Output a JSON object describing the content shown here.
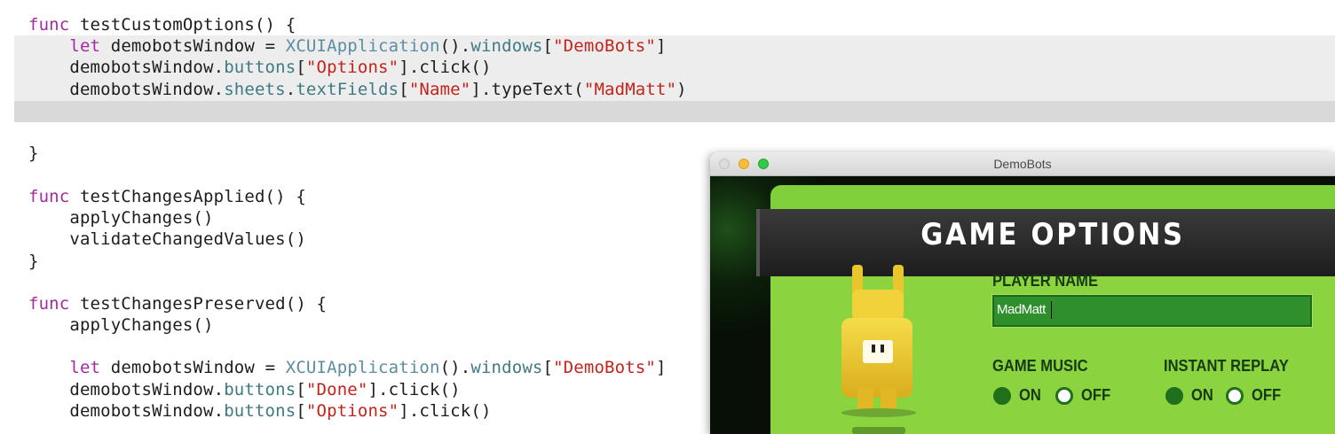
{
  "code": {
    "lines": [
      {
        "id": "l1",
        "segments": [
          {
            "t": "func",
            "c": "kw"
          },
          {
            "t": " testCustomOptions() {",
            "c": ""
          }
        ]
      },
      {
        "id": "l2",
        "segments": [
          {
            "t": "    ",
            "c": ""
          },
          {
            "t": "let",
            "c": "kw"
          },
          {
            "t": " demobotsWindow = ",
            "c": ""
          },
          {
            "t": "XCUIApplication",
            "c": "cls"
          },
          {
            "t": "().",
            "c": ""
          },
          {
            "t": "windows",
            "c": "prop"
          },
          {
            "t": "[",
            "c": ""
          },
          {
            "t": "\"DemoBots\"",
            "c": "str"
          },
          {
            "t": "]",
            "c": ""
          }
        ]
      },
      {
        "id": "l3",
        "segments": [
          {
            "t": "    demobotsWindow.",
            "c": ""
          },
          {
            "t": "buttons",
            "c": "prop"
          },
          {
            "t": "[",
            "c": ""
          },
          {
            "t": "\"Options\"",
            "c": "str"
          },
          {
            "t": "].click()",
            "c": ""
          }
        ]
      },
      {
        "id": "l4",
        "segments": [
          {
            "t": "    demobotsWindow.",
            "c": ""
          },
          {
            "t": "sheets",
            "c": "prop"
          },
          {
            "t": ".",
            "c": ""
          },
          {
            "t": "textFields",
            "c": "prop"
          },
          {
            "t": "[",
            "c": ""
          },
          {
            "t": "\"Name\"",
            "c": "str"
          },
          {
            "t": "].typeText(",
            "c": ""
          },
          {
            "t": "\"MadMatt\"",
            "c": "str"
          },
          {
            "t": ")",
            "c": ""
          }
        ]
      },
      {
        "id": "l5",
        "segments": [
          {
            "t": "}",
            "c": ""
          }
        ]
      },
      {
        "id": "l6",
        "segments": [
          {
            "t": "func",
            "c": "kw"
          },
          {
            "t": " testChangesApplied() {",
            "c": ""
          }
        ]
      },
      {
        "id": "l7",
        "segments": [
          {
            "t": "    applyChanges()",
            "c": ""
          }
        ]
      },
      {
        "id": "l8",
        "segments": [
          {
            "t": "    validateChangedValues()",
            "c": ""
          }
        ]
      },
      {
        "id": "l9",
        "segments": [
          {
            "t": "}",
            "c": ""
          }
        ]
      },
      {
        "id": "l10",
        "segments": [
          {
            "t": "func",
            "c": "kw"
          },
          {
            "t": " testChangesPreserved() {",
            "c": ""
          }
        ]
      },
      {
        "id": "l11",
        "segments": [
          {
            "t": "    applyChanges()",
            "c": ""
          }
        ]
      },
      {
        "id": "l12",
        "segments": [
          {
            "t": "    ",
            "c": ""
          },
          {
            "t": "let",
            "c": "kw"
          },
          {
            "t": " demobotsWindow = ",
            "c": ""
          },
          {
            "t": "XCUIApplication",
            "c": "cls"
          },
          {
            "t": "().",
            "c": ""
          },
          {
            "t": "windows",
            "c": "prop"
          },
          {
            "t": "[",
            "c": ""
          },
          {
            "t": "\"DemoBots\"",
            "c": "str"
          },
          {
            "t": "]",
            "c": ""
          }
        ]
      },
      {
        "id": "l13",
        "segments": [
          {
            "t": "    demobotsWindow.",
            "c": ""
          },
          {
            "t": "buttons",
            "c": "prop"
          },
          {
            "t": "[",
            "c": ""
          },
          {
            "t": "\"Done\"",
            "c": "str"
          },
          {
            "t": "].click()",
            "c": ""
          }
        ]
      },
      {
        "id": "l14",
        "segments": [
          {
            "t": "    demobotsWindow.",
            "c": ""
          },
          {
            "t": "buttons",
            "c": "prop"
          },
          {
            "t": "[",
            "c": ""
          },
          {
            "t": "\"Options\"",
            "c": "str"
          },
          {
            "t": "].click()",
            "c": ""
          }
        ]
      }
    ]
  },
  "window": {
    "title": "DemoBots",
    "game_options": {
      "heading": "GAME OPTIONS",
      "player_name_label": "PLAYER NAME",
      "player_name_value": "MadMatt",
      "game_music_label": "GAME MUSIC",
      "instant_replay_label": "INSTANT REPLAY",
      "game_music": {
        "on_label": "ON",
        "off_label": "OFF",
        "selected": "ON"
      },
      "instant_replay": {
        "on_label": "ON",
        "off_label": "OFF",
        "selected": "ON"
      }
    }
  },
  "colors": {
    "keyword": "#a42aa0",
    "type": "#5b8da3",
    "property": "#3f7a82",
    "string": "#c3231b",
    "game_green": "#8bd33f"
  }
}
